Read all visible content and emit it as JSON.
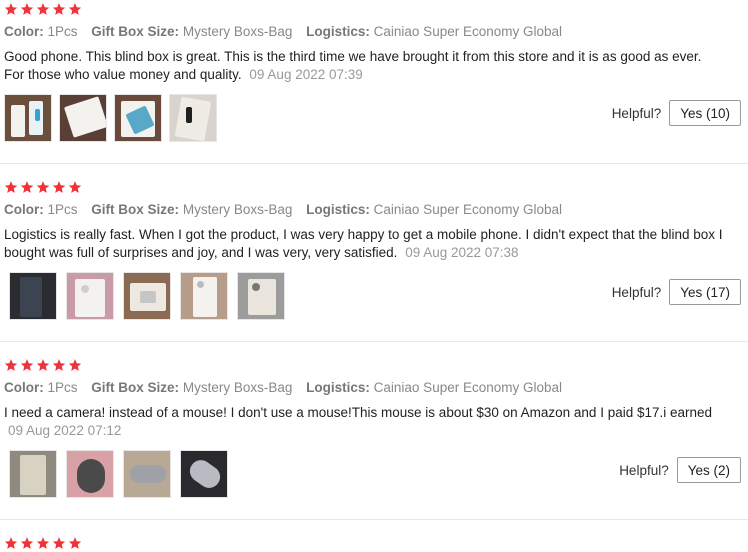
{
  "labels": {
    "color": "Color:",
    "gift_box_size": "Gift Box Size:",
    "logistics": "Logistics:",
    "helpful": "Helpful?"
  },
  "colors": {
    "star": "#f0333a",
    "meta_value": "#888888",
    "date": "#999999"
  },
  "reviews": [
    {
      "rating": 5,
      "color": "1Pcs",
      "gift_box_size": "Mystery Boxs-Bag",
      "logistics": "Cainiao Super Economy Global",
      "text": "Good phone. This blind box is great. This is the third time we have brought it from this store and it is as good as ever. For those who value money and quality.",
      "date": "09 Aug 2022 07:39",
      "photo_count": 4,
      "helpful_yes": "Yes (10)"
    },
    {
      "rating": 5,
      "color": "1Pcs",
      "gift_box_size": "Mystery Boxs-Bag",
      "logistics": "Cainiao Super Economy Global",
      "text": "Logistics is really fast. When I got the product, I was very happy to get a mobile phone. I didn't expect that the blind box I bought was full of surprises and joy, and I was very, very satisfied.",
      "date": "09 Aug 2022 07:38",
      "photo_count": 5,
      "helpful_yes": "Yes (17)"
    },
    {
      "rating": 5,
      "color": "1Pcs",
      "gift_box_size": "Mystery Boxs-Bag",
      "logistics": "Cainiao Super Economy Global",
      "text": "I need a camera! instead of a mouse! I don't use a mouse!This mouse is about $30 on Amazon and I paid $17.i earned",
      "date": "09 Aug 2022 07:12",
      "photo_count": 4,
      "helpful_yes": "Yes (2)"
    }
  ]
}
